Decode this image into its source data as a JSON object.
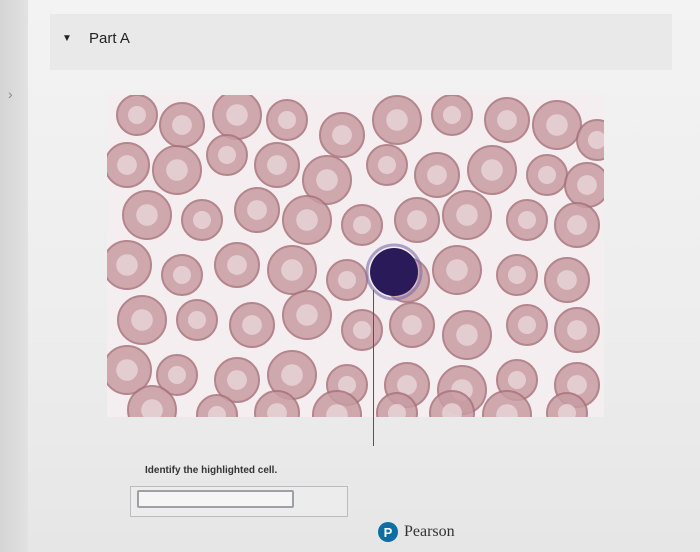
{
  "part": {
    "title": "Part A",
    "collapse_icon": "caret-down-icon"
  },
  "nav": {
    "back_icon": "chevron-left-icon"
  },
  "question": {
    "prompt": "Identify the highlighted cell.",
    "answer_value": ""
  },
  "brand": {
    "logo_letter": "P",
    "name": "Pearson"
  },
  "colors": {
    "rbc_fill": "#c99ca3",
    "rbc_rim": "#a9737c",
    "rbc_center": "#e8d6d9",
    "wbc": "#2a1a5a",
    "background": "#f4eef0",
    "brand": "#0b6fa4"
  }
}
